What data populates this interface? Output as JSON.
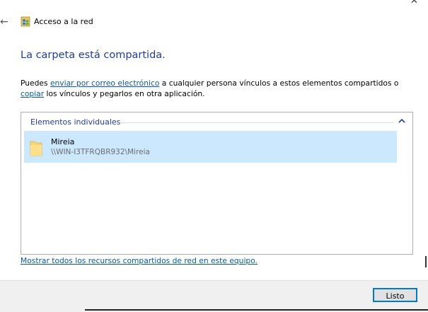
{
  "window": {
    "title": "Acceso a la red"
  },
  "content": {
    "heading": "La carpeta está compartida.",
    "desc_part1": "Puedes ",
    "desc_email_link": "enviar por correo electrónico",
    "desc_part2": " a cualquier persona vínculos a estos elementos compartidos o ",
    "desc_copy_link": "copiar",
    "desc_part3": " los vínculos y pegarlos en otra aplicación."
  },
  "list": {
    "group_header": "Elementos individuales",
    "items": [
      {
        "name": "Mireia",
        "path": "\\\\WIN-I3TFRQBR932\\Mireia"
      }
    ]
  },
  "footer_link": "Mostrar todos los recursos compartidos de red en este equipo.",
  "buttons": {
    "done_label": "Listo"
  },
  "colors": {
    "heading": "#1e3ea0",
    "link": "#0a5aa7",
    "selection": "#cce8ff",
    "accent": "#0078d7"
  }
}
